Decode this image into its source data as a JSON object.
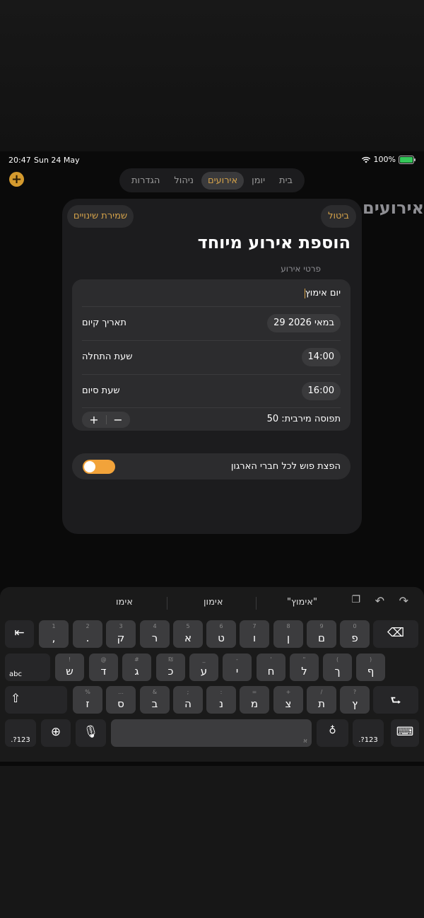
{
  "status": {
    "time": "20:47",
    "date": "Sun 24 May",
    "battery": "100%"
  },
  "tabs": [
    {
      "label": "בית",
      "active": false
    },
    {
      "label": "יומן",
      "active": false
    },
    {
      "label": "אירועים",
      "active": true
    },
    {
      "label": "ניהול",
      "active": false
    },
    {
      "label": "הגדרות",
      "active": false
    }
  ],
  "background_title": "אירועים",
  "modal": {
    "save_label": "שמירת שינויים",
    "cancel_label": "ביטול",
    "title": "הוספת אירוע מיוחד",
    "section_label": "פרטי אירוע",
    "event_name_value": "יום אימוץ",
    "date_label": "תאריך קיום",
    "date_value": "29 במאי 2026",
    "start_label": "שעת התחלה",
    "start_value": "14:00",
    "end_label": "שעת סיום",
    "end_value": "16:00",
    "capacity_label": "תפוסה מירבית: 50",
    "plus": "+",
    "minus": "−",
    "push_label": "הפצת פוש לכל חברי הארגון",
    "push_enabled": true
  },
  "keyboard": {
    "suggestions": [
      "\"אימוץ\"",
      "אימון",
      "אימו"
    ],
    "row1": [
      {
        "main": "פ",
        "alt": "0"
      },
      {
        "main": "ם",
        "alt": "9"
      },
      {
        "main": "ן",
        "alt": "8"
      },
      {
        "main": "ו",
        "alt": "7"
      },
      {
        "main": "ט",
        "alt": "6"
      },
      {
        "main": "א",
        "alt": "5"
      },
      {
        "main": "ר",
        "alt": "4"
      },
      {
        "main": "ק",
        "alt": "3"
      },
      {
        "main": ".",
        "alt": "2"
      },
      {
        "main": ",",
        "alt": "1"
      }
    ],
    "row2": [
      {
        "main": "ף",
        "alt": ")"
      },
      {
        "main": "ך",
        "alt": "("
      },
      {
        "main": "ל",
        "alt": "\""
      },
      {
        "main": "ח",
        "alt": "'"
      },
      {
        "main": "י",
        "alt": "-"
      },
      {
        "main": "ע",
        "alt": "_"
      },
      {
        "main": "כ",
        "alt": "₪"
      },
      {
        "main": "ג",
        "alt": "#"
      },
      {
        "main": "ד",
        "alt": "@"
      },
      {
        "main": "ש",
        "alt": "!"
      }
    ],
    "row3": [
      {
        "main": "ץ",
        "alt": "?"
      },
      {
        "main": "ת",
        "alt": "/"
      },
      {
        "main": "צ",
        "alt": "+"
      },
      {
        "main": "מ",
        "alt": "="
      },
      {
        "main": "נ",
        "alt": ":"
      },
      {
        "main": "ה",
        "alt": ";"
      },
      {
        "main": "ב",
        "alt": "&"
      },
      {
        "main": "ס",
        "alt": "…"
      },
      {
        "main": "ז",
        "alt": "%"
      }
    ],
    "abc_label": "abc",
    "num_label": ".?123",
    "space_hint": "א"
  }
}
